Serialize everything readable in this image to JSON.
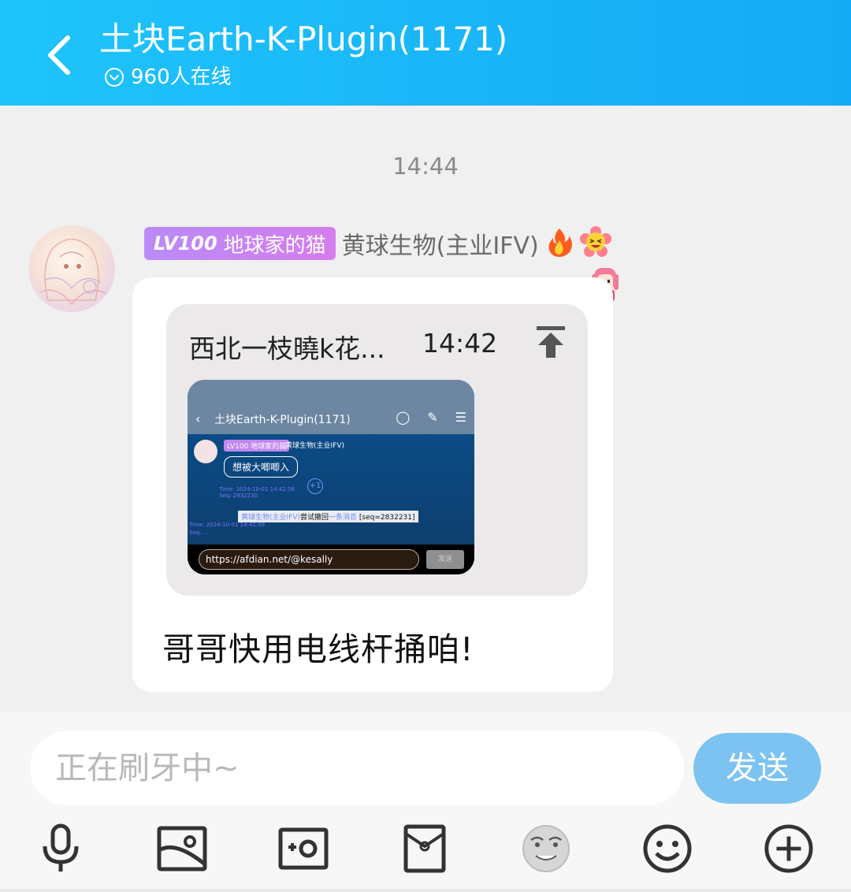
{
  "header": {
    "title": "土块Earth-K-Plugin(1171)",
    "online_text": "960人在线",
    "background": "#15aaf5"
  },
  "chat": {
    "timestamp": "14:44",
    "message": {
      "level_label": "LV100",
      "level_title": "地球家的猫",
      "sender_name": "黄球生物(主业IFV)",
      "badges": [
        "fire-icon",
        "laughing-flower-icon",
        "anime-girl-sticker-icon"
      ],
      "quote": {
        "author": "西北一枝曉k花...",
        "time": "14:42",
        "screenshot": {
          "title": "土块Earth-K-Plugin(1171)",
          "badge": "LV100 地球家的猫",
          "name": "黄球生物(主业IFV)",
          "bubble_text": "想被大唧唧入",
          "plus": "+1",
          "meta_line1": "Time: 2024-10-01 14:42:08",
          "meta_line1b": "Seq: 2832230",
          "system_prefix": "黄球生物(主业IFV)",
          "system_middle": "尝试撤回",
          "system_link": "一条消息",
          "system_seq": "[seq=2832231]",
          "meta_line2": "Time: 2024-10-01 14:42:09",
          "meta_line2b": "Seq: ...",
          "input_text": "https://afdian.net/@kesally",
          "send_label": "发送"
        }
      },
      "text": "哥哥快用电线杆捅咱!"
    }
  },
  "input": {
    "placeholder": "正在刷牙中~",
    "send_label": "发送",
    "send_color": "#7cc3f2"
  },
  "toolbar": [
    "microphone-icon",
    "image-icon",
    "camera-icon",
    "red-packet-icon",
    "face-sticker-icon",
    "emoji-icon",
    "plus-icon"
  ]
}
